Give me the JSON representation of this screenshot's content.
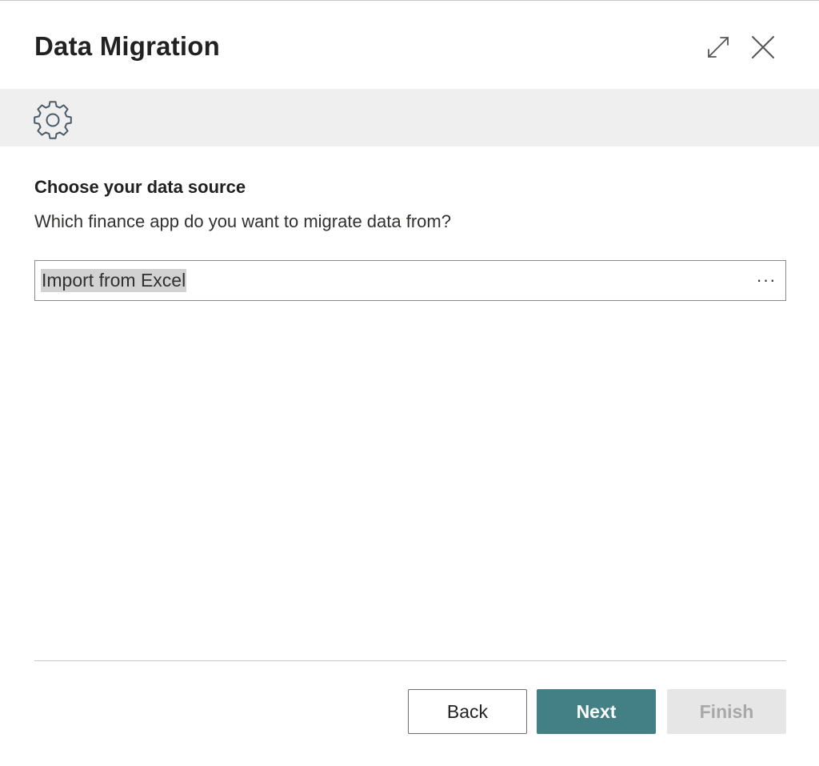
{
  "dialog": {
    "title": "Data Migration",
    "icons": {
      "expand": "expand-icon",
      "close": "close-icon",
      "banner": "gear-icon",
      "lookup": "ellipsis-icon"
    }
  },
  "step": {
    "heading": "Choose your data source",
    "question": "Which finance app do you want to migrate data from?",
    "source_field": {
      "value": "Import from Excel",
      "lookup_label": "···"
    }
  },
  "footer": {
    "back_label": "Back",
    "next_label": "Next",
    "finish_label": "Finish"
  },
  "colors": {
    "primary": "#438086",
    "banner_bg": "#efefef",
    "disabled_bg": "#e6e6e6",
    "disabled_text": "#a8a8a8"
  }
}
